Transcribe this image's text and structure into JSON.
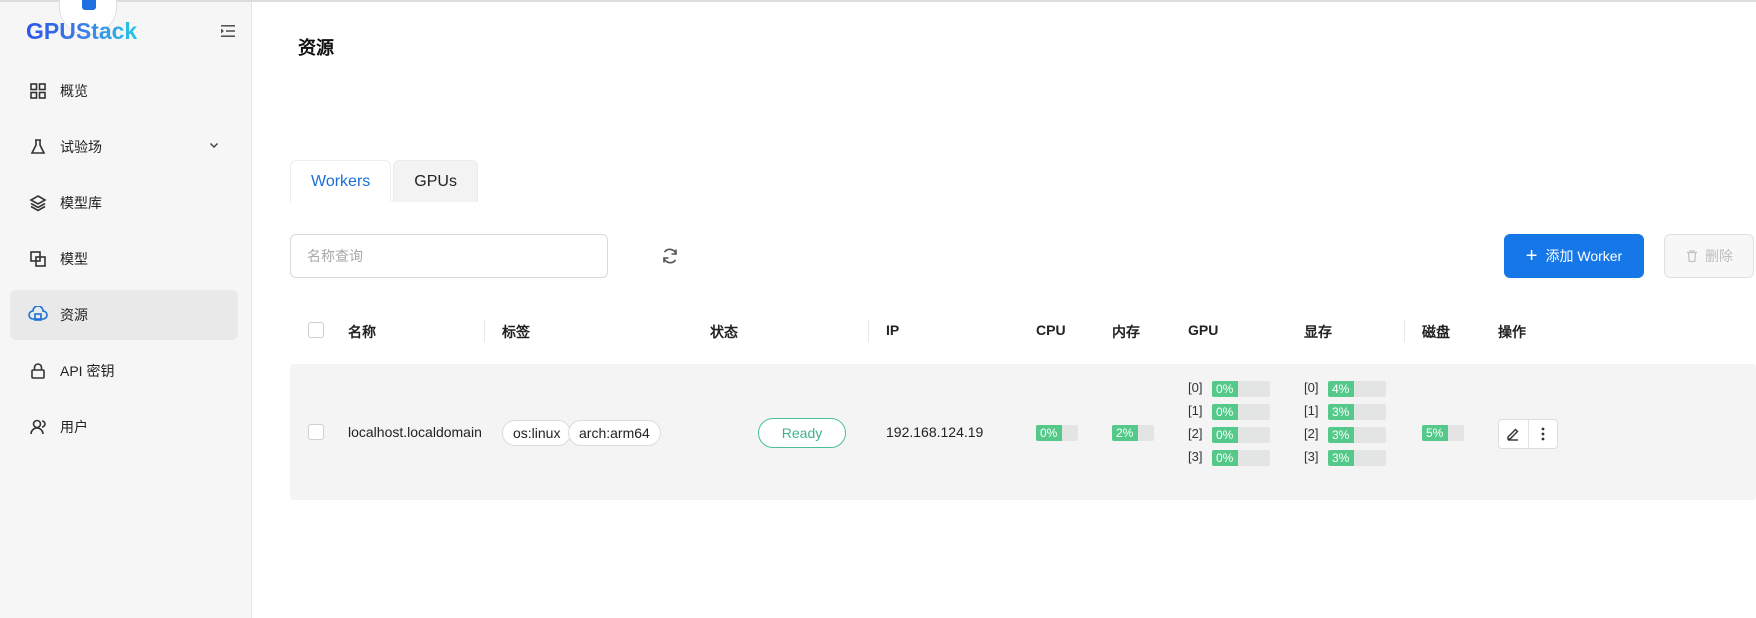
{
  "app": {
    "logo_text": "GPUStack"
  },
  "sidebar": {
    "items": [
      {
        "label": "概览",
        "icon": "grid-icon",
        "active": false
      },
      {
        "label": "试验场",
        "icon": "flask-icon",
        "active": false,
        "expandable": true
      },
      {
        "label": "模型库",
        "icon": "layers-icon",
        "active": false
      },
      {
        "label": "模型",
        "icon": "model-icon",
        "active": false
      },
      {
        "label": "资源",
        "icon": "cloud-server-icon",
        "active": true
      },
      {
        "label": "API 密钥",
        "icon": "lock-icon",
        "active": false
      },
      {
        "label": "用户",
        "icon": "user-icon",
        "active": false
      }
    ]
  },
  "page": {
    "title": "资源"
  },
  "tabs": [
    {
      "label": "Workers",
      "active": true
    },
    {
      "label": "GPUs",
      "active": false
    }
  ],
  "toolbar": {
    "search_placeholder": "名称查询",
    "add_label": "添加 Worker",
    "delete_label": "删除"
  },
  "table": {
    "headers": {
      "name": "名称",
      "labels": "标签",
      "status": "状态",
      "ip": "IP",
      "cpu": "CPU",
      "memory": "内存",
      "gpu": "GPU",
      "vram": "显存",
      "disk": "磁盘",
      "actions": "操作"
    },
    "rows": [
      {
        "name": "localhost.localdomain",
        "tags": [
          "os:linux",
          "arch:arm64"
        ],
        "status": "Ready",
        "ip": "192.168.124.19",
        "cpu": {
          "text": "0%",
          "percent": 0
        },
        "memory": {
          "text": "2%",
          "percent": 2
        },
        "gpu": [
          {
            "index": "[0]",
            "text": "0%",
            "percent": 0
          },
          {
            "index": "[1]",
            "text": "0%",
            "percent": 0
          },
          {
            "index": "[2]",
            "text": "0%",
            "percent": 0
          },
          {
            "index": "[3]",
            "text": "0%",
            "percent": 0
          }
        ],
        "vram": [
          {
            "index": "[0]",
            "text": "4%",
            "percent": 4
          },
          {
            "index": "[1]",
            "text": "3%",
            "percent": 3
          },
          {
            "index": "[2]",
            "text": "3%",
            "percent": 3
          },
          {
            "index": "[3]",
            "text": "3%",
            "percent": 3
          }
        ],
        "disk": {
          "text": "5%",
          "percent": 5
        }
      }
    ]
  },
  "colors": {
    "primary": "#1677e8",
    "status_ready": "#3db488",
    "progress_fill": "#55c98a",
    "progress_track": "#e2e5e3"
  }
}
